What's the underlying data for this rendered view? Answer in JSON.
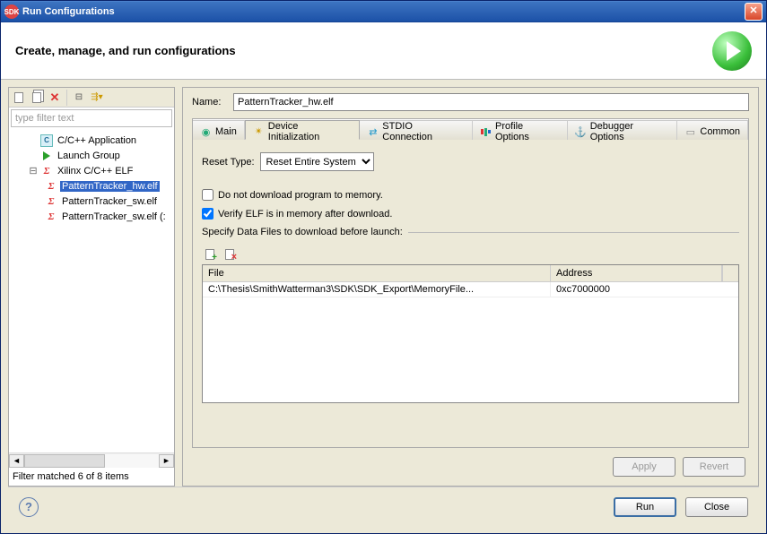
{
  "window": {
    "title": "Run Configurations"
  },
  "header": {
    "title": "Create, manage, and run configurations"
  },
  "left_toolbar": {
    "new_icon": "new-config",
    "duplicate_icon": "duplicate-config",
    "delete_icon": "delete-config",
    "collapse_icon": "collapse-all",
    "filter_icon": "filter-menu"
  },
  "filter_placeholder": "type filter text",
  "tree": {
    "items": [
      {
        "icon": "c-app",
        "label": "C/C++ Application",
        "level": 1
      },
      {
        "icon": "launch-group",
        "label": "Launch Group",
        "level": 1
      },
      {
        "icon": "xilinx",
        "label": "Xilinx C/C++ ELF",
        "level": 1,
        "expanded": true
      },
      {
        "icon": "xilinx",
        "label": "PatternTracker_hw.elf",
        "level": 2,
        "selected": true
      },
      {
        "icon": "xilinx",
        "label": "PatternTracker_sw.elf",
        "level": 2
      },
      {
        "icon": "xilinx",
        "label": "PatternTracker_sw.elf (:",
        "level": 2
      }
    ]
  },
  "filter_status": "Filter matched 6 of 8 items",
  "name_label": "Name:",
  "name_value": "PatternTracker_hw.elf",
  "tabs": [
    {
      "id": "main",
      "label": "Main"
    },
    {
      "id": "device-init",
      "label": "Device Initialization",
      "active": true
    },
    {
      "id": "stdio",
      "label": "STDIO Connection"
    },
    {
      "id": "profile",
      "label": "Profile Options"
    },
    {
      "id": "debugger",
      "label": "Debugger Options"
    },
    {
      "id": "common",
      "label": "Common"
    }
  ],
  "device_init": {
    "reset_label": "Reset Type:",
    "reset_value": "Reset Entire System",
    "no_download_label": "Do not download program to memory.",
    "no_download_checked": false,
    "verify_label": "Verify ELF is in memory after download.",
    "verify_checked": true,
    "data_files_legend": "Specify Data Files to download before launch:",
    "table_headers": {
      "file": "File",
      "address": "Address"
    },
    "table_rows": [
      {
        "file": "C:\\Thesis\\SmithWatterman3\\SDK\\SDK_Export\\MemoryFile...",
        "address": "0xc7000000"
      }
    ]
  },
  "buttons": {
    "apply": "Apply",
    "revert": "Revert",
    "run": "Run",
    "close": "Close"
  }
}
